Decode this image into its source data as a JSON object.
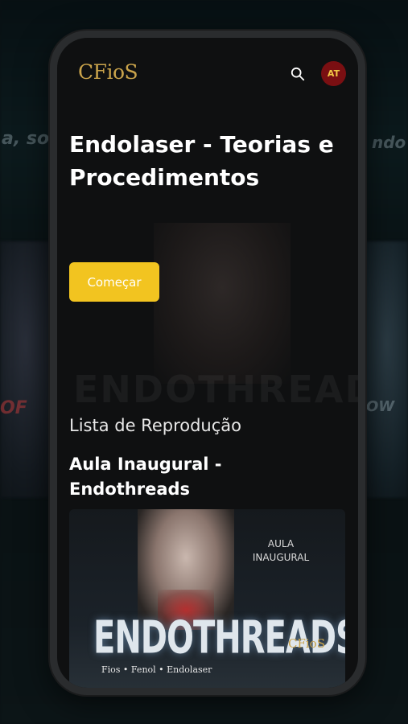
{
  "app": {
    "logo_text": "CFioS",
    "avatar_initials": "AT",
    "accent_color": "#f2c420",
    "avatar_color": "#7a0f12",
    "icons": {
      "search": "search-icon"
    }
  },
  "hero": {
    "title": "Endolaser - Teorias e Procedimentos",
    "cta_label": "Começar"
  },
  "playlist": {
    "section_label": "Lista de Reprodução",
    "episode_title": "Aula Inaugural - Endothreads",
    "thumbnail": {
      "caption": "AULA INAUGURAL",
      "headline": "ENDOTHREADS",
      "logo_text": "CFioS",
      "subtitle": "Fios • Fenol • Endolaser"
    }
  }
}
